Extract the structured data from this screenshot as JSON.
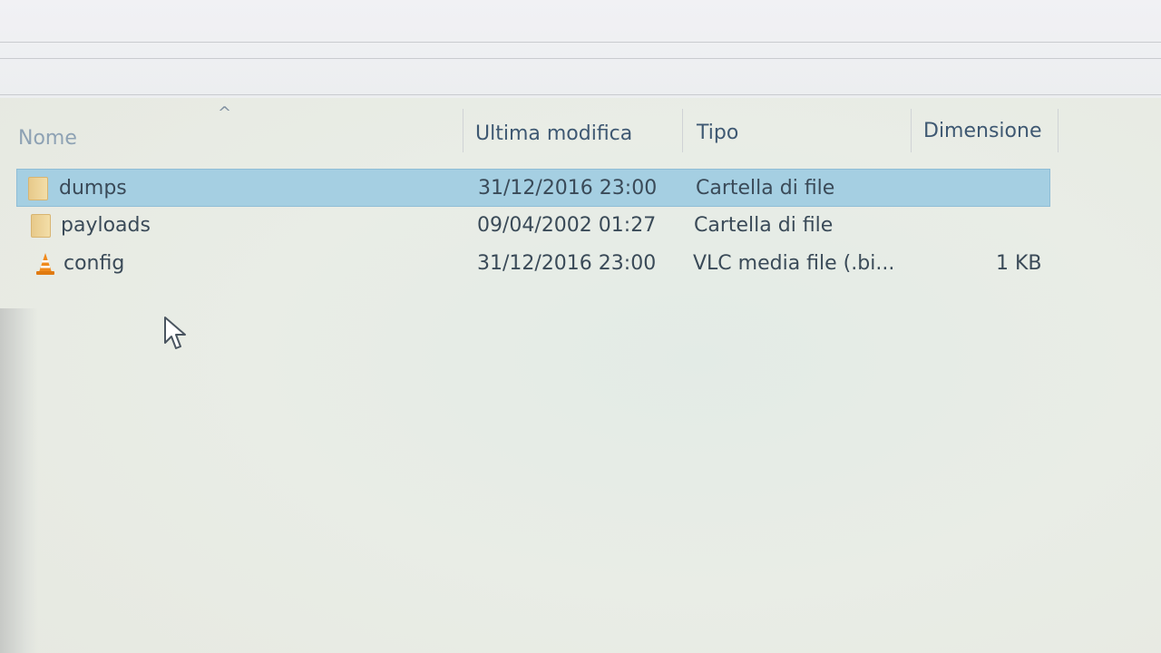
{
  "columns": {
    "name": "Nome",
    "modified": "Ultima modifica",
    "type": "Tipo",
    "size": "Dimensione"
  },
  "files": [
    {
      "icon": "folder-icon",
      "name": "dumps",
      "modified": "31/12/2016 23:00",
      "type": "Cartella di file",
      "size": "",
      "selected": true
    },
    {
      "icon": "folder-icon",
      "name": "payloads",
      "modified": "09/04/2002 01:27",
      "type": "Cartella di file",
      "size": "",
      "selected": false
    },
    {
      "icon": "vlc-icon",
      "name": "config",
      "modified": "31/12/2016 23:00",
      "type": "VLC media file (.bi...",
      "size": "1 KB",
      "selected": false
    }
  ],
  "colors": {
    "selection": "#a5cfe2",
    "header_text": "#3e5872",
    "folder": "#f0d9a0",
    "vlc_orange": "#f08a1c"
  }
}
